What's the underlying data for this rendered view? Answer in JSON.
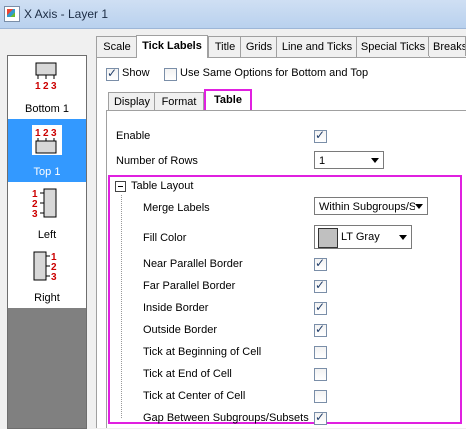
{
  "window": {
    "title": "X Axis - Layer 1"
  },
  "axes": [
    {
      "label": "Bottom 1",
      "selected": false
    },
    {
      "label": "Top 1",
      "selected": true
    },
    {
      "label": "Left",
      "selected": false
    },
    {
      "label": "Right",
      "selected": false
    }
  ],
  "axis_digits": {
    "one": "1",
    "two": "2",
    "three": "3"
  },
  "tabs": [
    "Scale",
    "Tick Labels",
    "Title",
    "Grids",
    "Line and Ticks",
    "Special Ticks",
    "Breaks"
  ],
  "active_tab": "Tick Labels",
  "show": {
    "label": "Show",
    "checked": true
  },
  "same_options": {
    "label": "Use Same Options for Bottom and Top",
    "checked": false
  },
  "subtabs": [
    "Display",
    "Format",
    "Table"
  ],
  "active_subtab": "Table",
  "enable": {
    "label": "Enable",
    "checked": true
  },
  "num_rows": {
    "label": "Number of Rows",
    "value": "1"
  },
  "table_layout": {
    "title": "Table Layout",
    "merge_labels": {
      "label": "Merge Labels",
      "value": "Within Subgroups/Subse"
    },
    "fill_color": {
      "label": "Fill Color",
      "value": "LT Gray",
      "swatch": "#c0c0c0"
    },
    "options": [
      {
        "label": "Near Parallel Border",
        "checked": true
      },
      {
        "label": "Far Parallel Border",
        "checked": true
      },
      {
        "label": "Inside Border",
        "checked": true
      },
      {
        "label": "Outside Border",
        "checked": true
      },
      {
        "label": "Tick at Beginning of Cell",
        "checked": false
      },
      {
        "label": "Tick at End of Cell",
        "checked": false
      },
      {
        "label": "Tick at Center of Cell",
        "checked": false
      },
      {
        "label": "Gap Between Subgroups/Subsets",
        "checked": true
      }
    ]
  },
  "colors": {
    "accent": "#3399ff",
    "highlight": "#e020e0",
    "digits": "#cc0000"
  }
}
